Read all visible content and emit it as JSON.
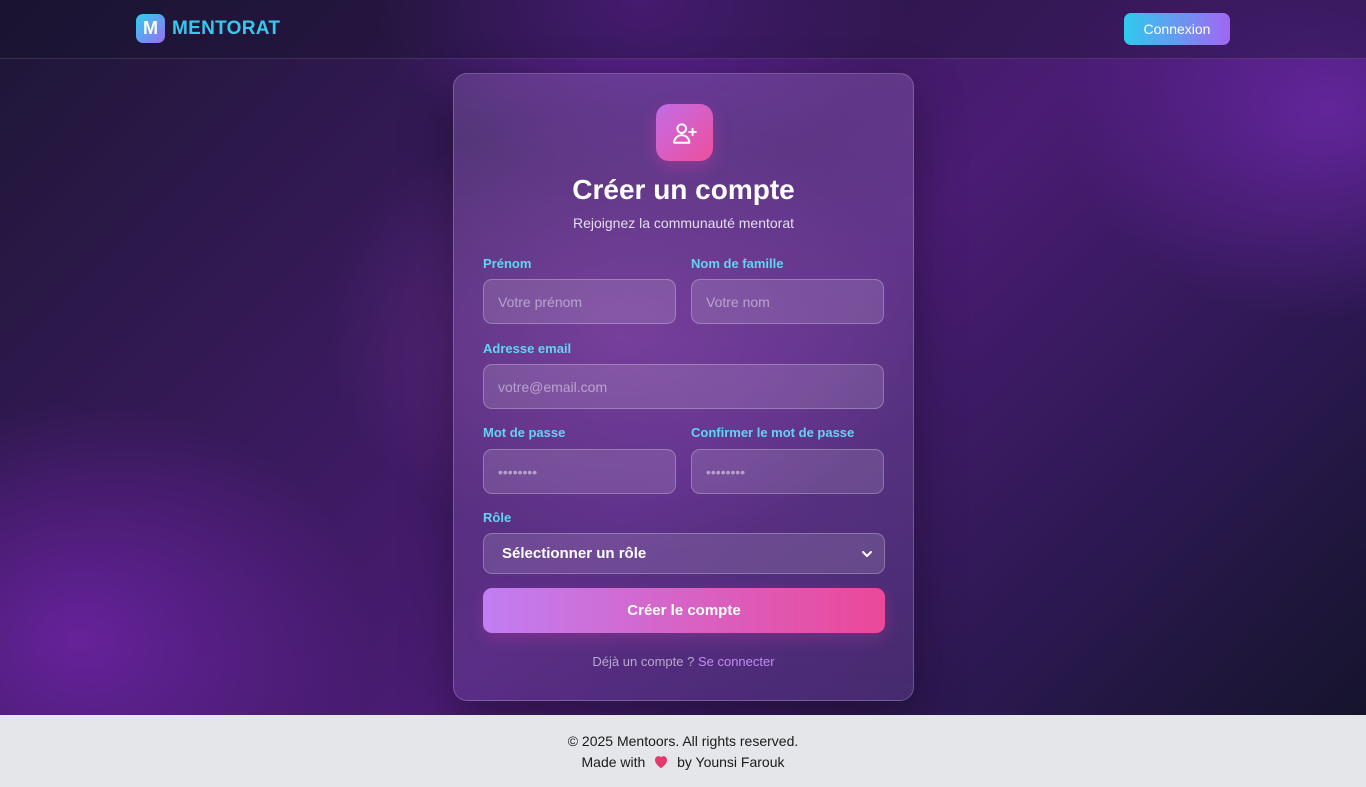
{
  "navbar": {
    "logo_letter": "M",
    "brand_name": "MENTORAT",
    "login_label": "Connexion"
  },
  "card": {
    "icon": "user-plus-icon",
    "title": "Créer un compte",
    "subtitle": "Rejoignez la communauté mentorat"
  },
  "form": {
    "first_name": {
      "label": "Prénom",
      "placeholder": "Votre prénom"
    },
    "last_name": {
      "label": "Nom de famille",
      "placeholder": "Votre nom"
    },
    "email": {
      "label": "Adresse email",
      "placeholder": "votre@email.com"
    },
    "password": {
      "label": "Mot de passe",
      "placeholder": "••••••••"
    },
    "confirm_password": {
      "label": "Confirmer le mot de passe",
      "placeholder": "••••••••"
    },
    "role": {
      "label": "Rôle",
      "selected": "Sélectionner un rôle"
    },
    "submit_label": "Créer le compte",
    "have_account_text": "Déjà un compte ?",
    "signin_link": "Se connecter"
  },
  "footer": {
    "copyright": "© 2025 Mentoors. All rights reserved.",
    "made_with": "Made with",
    "by_author": "by Younsi Farouk"
  },
  "colors": {
    "accent_cyan": "#38c8ee",
    "accent_purple": "#a266f2",
    "accent_pink": "#ec4898",
    "label_color": "#62d3f3"
  }
}
